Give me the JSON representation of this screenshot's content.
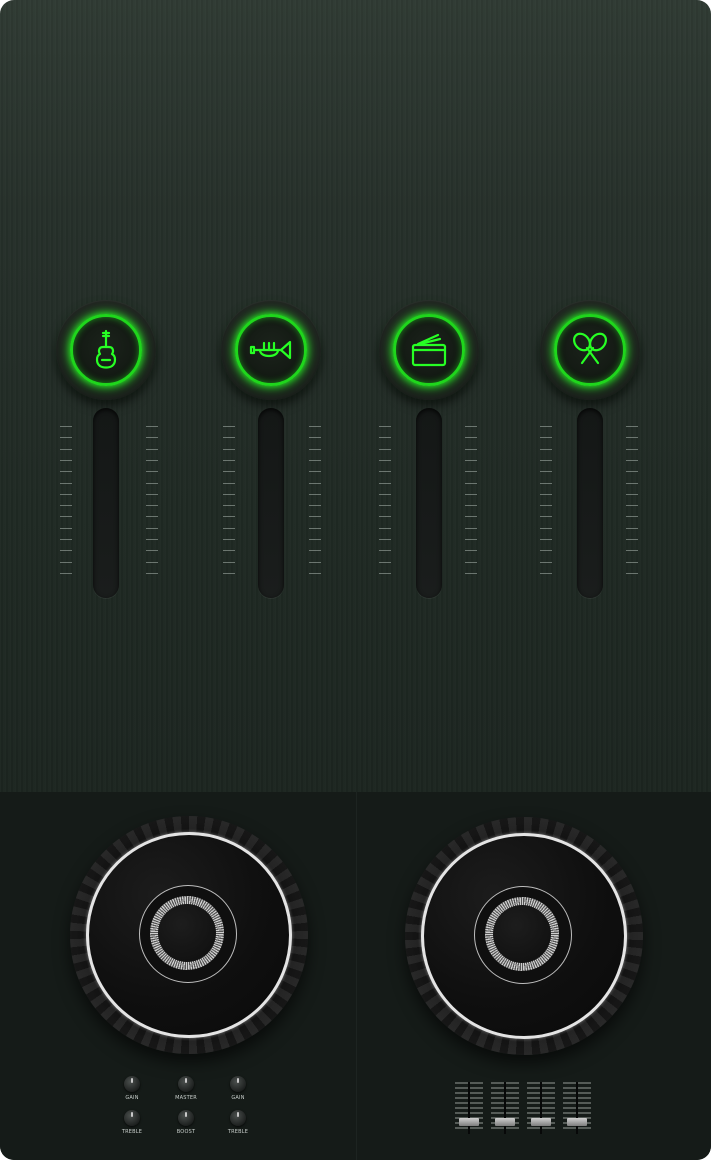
{
  "channels": [
    {
      "icon": "guitar-icon",
      "accent": "#1fd61c"
    },
    {
      "icon": "trumpet-icon",
      "accent": "#1fd61c"
    },
    {
      "icon": "drum-icon",
      "accent": "#1fd61c"
    },
    {
      "icon": "maracas-icon",
      "accent": "#1fd61c"
    }
  ],
  "decks": [
    {
      "name": "left-deck"
    },
    {
      "name": "right-deck"
    }
  ],
  "mixer_knobs": {
    "gain_left": "GAIN",
    "master": "MASTER",
    "gain_right": "GAIN",
    "treble_left": "TREBLE",
    "boost": "BOOST",
    "treble_right": "TREBLE"
  },
  "colors": {
    "accent_green": "#1fd61c",
    "panel_top": "#2f3a33",
    "panel_bottom": "#151b18"
  }
}
